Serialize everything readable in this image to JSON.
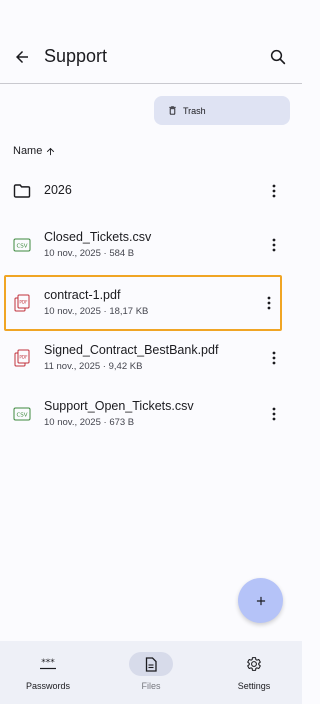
{
  "header": {
    "title": "Support",
    "back_icon": "arrow-left-icon",
    "search_icon": "search-icon"
  },
  "trash": {
    "label": "Trash",
    "icon": "trash-icon"
  },
  "sort": {
    "label": "Name",
    "direction": "ascending",
    "icon": "arrow-up-icon"
  },
  "files": [
    {
      "name": "2026",
      "meta": "",
      "type": "folder",
      "icon": "folder-icon"
    },
    {
      "name": "Closed_Tickets.csv",
      "meta": "10 nov., 2025 · 584 B",
      "type": "csv",
      "icon": "csv-file-icon"
    },
    {
      "name": "contract-1.pdf",
      "meta": "10 nov., 2025 · 18,17 KB",
      "type": "pdf",
      "icon": "pdf-file-icon",
      "selected": true
    },
    {
      "name": "Signed_Contract_BestBank.pdf",
      "meta": "11 nov., 2025 · 9,42 KB",
      "type": "pdf",
      "icon": "pdf-file-icon"
    },
    {
      "name": "Support_Open_Tickets.csv",
      "meta": "10 nov., 2025 · 673 B",
      "type": "csv",
      "icon": "csv-file-icon"
    }
  ],
  "fab": {
    "label": "+",
    "icon": "plus-icon"
  },
  "nav": [
    {
      "label": "Passwords",
      "icon": "password-dots-icon",
      "active": false
    },
    {
      "label": "Files",
      "icon": "document-icon",
      "active": true
    },
    {
      "label": "Settings",
      "icon": "gear-icon",
      "active": false
    }
  ],
  "colors": {
    "accent": "#b5c3f8",
    "selection": "#f0a524",
    "pdf": "#c0303a",
    "csv": "#3d8a3d",
    "trash_bg": "#dfe3f3"
  }
}
